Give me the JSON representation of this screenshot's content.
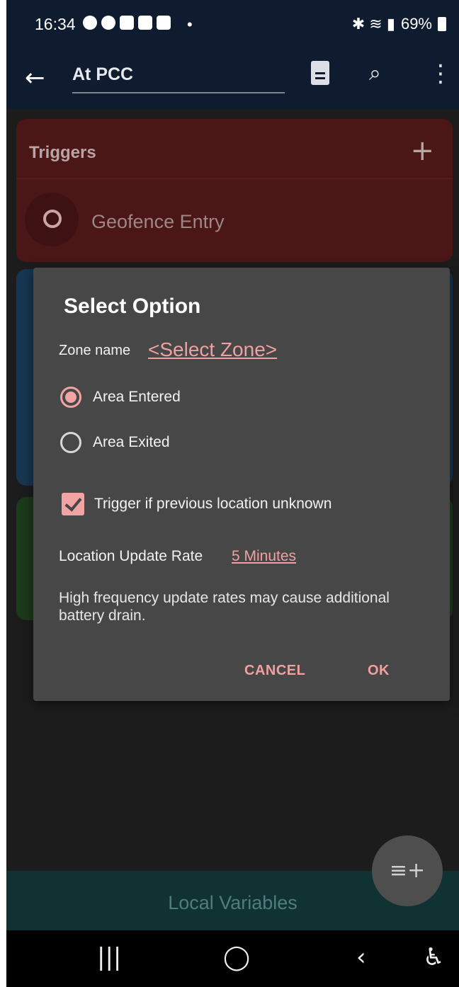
{
  "status_bar": {
    "time": "16:34",
    "dot": "•",
    "battery_percent": "69%",
    "right_icons": "✱ ≋ ▮"
  },
  "app_bar": {
    "back_icon": "←",
    "title": "At PCC",
    "search_icon": "⌕",
    "more_icon": "⋮"
  },
  "triggers_card": {
    "header": "Triggers",
    "add_icon": "+",
    "item_label": "Geofence Entry"
  },
  "dialog": {
    "title": "Select Option",
    "zone_label": "Zone name",
    "zone_value": "<Select Zone>",
    "radio_options": [
      {
        "label": "Area Entered",
        "selected": true
      },
      {
        "label": "Area Exited",
        "selected": false
      }
    ],
    "checkbox_label": "Trigger if previous location unknown",
    "checkbox_checked": true,
    "rate_label": "Location Update Rate",
    "rate_value": "5 Minutes",
    "note": "High frequency update rates may cause additional battery drain.",
    "cancel_label": "CANCEL",
    "ok_label": "OK"
  },
  "bottom_bar": {
    "label": "Local Variables"
  },
  "fab": {
    "icon": "≡+"
  },
  "nav_bar": {
    "recents": "|||",
    "home": "◯",
    "back": "‹",
    "accessibility": "♿"
  }
}
